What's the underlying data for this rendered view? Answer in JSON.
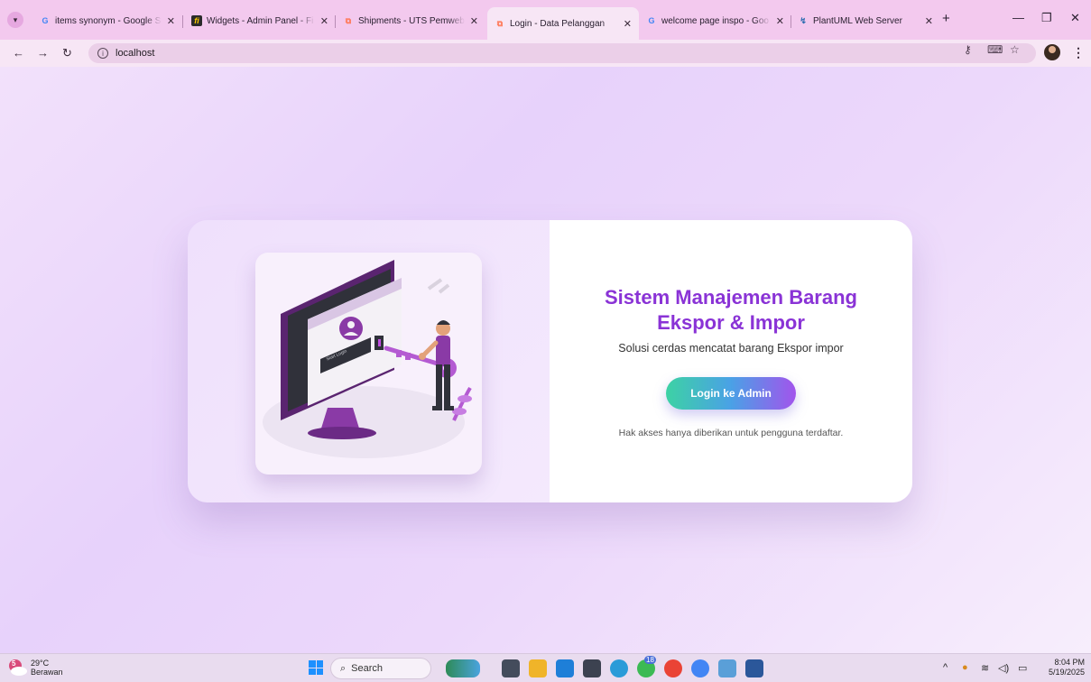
{
  "browser": {
    "tabs": [
      {
        "title": "items synonym - Google Se",
        "favicon": "google-icon"
      },
      {
        "title": "Widgets - Admin Panel - Fi",
        "favicon": "filament-icon"
      },
      {
        "title": "Shipments - UTS Pemweb",
        "favicon": "laravel-icon"
      },
      {
        "title": "Login - Data Pelanggan",
        "favicon": "laravel-icon",
        "active": true
      },
      {
        "title": "welcome page inspo - Goo",
        "favicon": "google-icon"
      },
      {
        "title": "PlantUML Web Server",
        "favicon": "plantuml-icon"
      }
    ],
    "new_tab_label": "+",
    "address": "localhost"
  },
  "page": {
    "title_line1": "Sistem Manajemen Barang",
    "title_line2": "Ekspor & Impor",
    "subtitle": "Solusi cerdas mencatat barang Ekspor impor",
    "login_button": "Login ke Admin",
    "note": "Hak akses hanya diberikan untuk pengguna terdaftar.",
    "illustration": {
      "screen_label": "Start Login"
    },
    "colors": {
      "title": "#8a33d6",
      "button_gradient": [
        "#3dd2a4",
        "#4aa1e6",
        "#a254ec"
      ],
      "background": "#e7d2fb"
    }
  },
  "taskbar": {
    "weather_temp": "29°C",
    "weather_desc": "Berawan",
    "weather_badge": "5",
    "search_label": "Search",
    "chrome_badge": "18",
    "time": "8:04 PM",
    "date": "5/19/2025"
  }
}
